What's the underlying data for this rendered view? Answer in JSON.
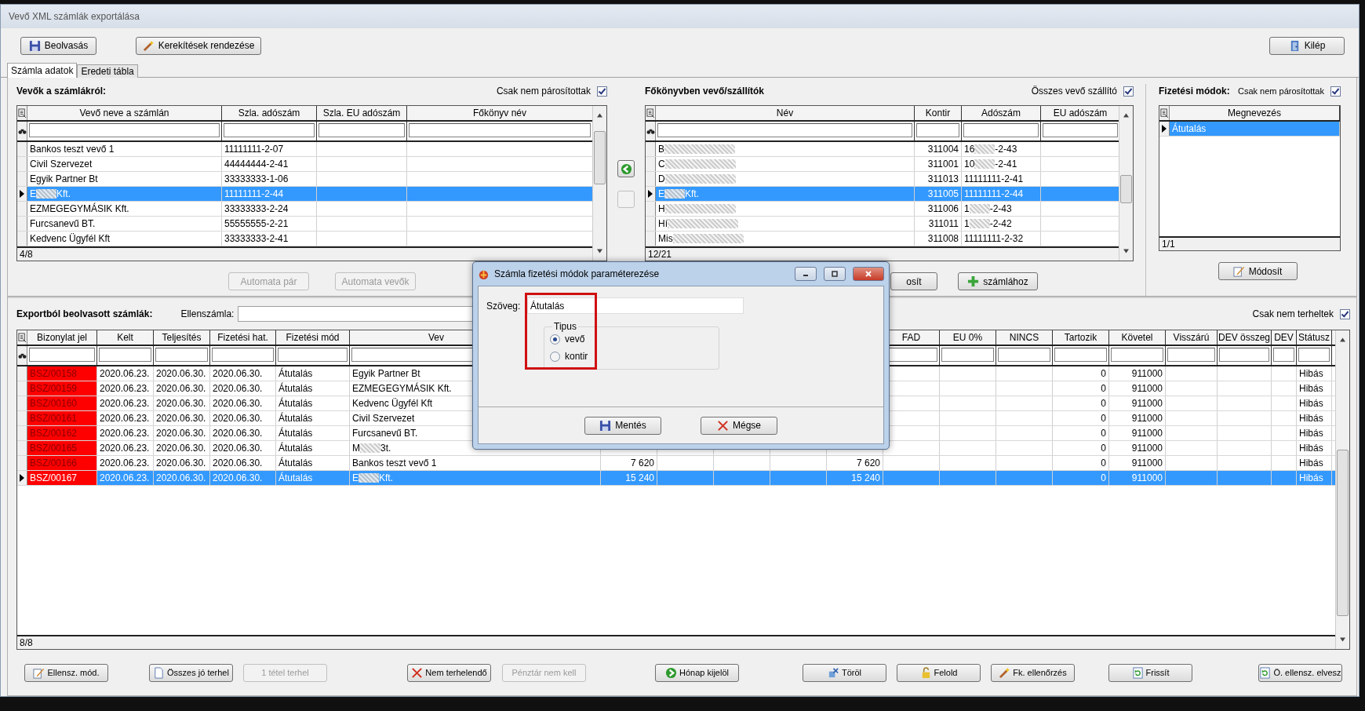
{
  "window": {
    "title": "Vevő XML számlák exportálása"
  },
  "toolbar": [
    {
      "label": "Beolvasás"
    },
    {
      "label": "Kerekítések rendezése"
    }
  ],
  "exit_button": {
    "label": "Kilép"
  },
  "tabs": [
    {
      "label": "Számla adatok",
      "selected": true
    },
    {
      "label": "Eredeti tábla",
      "selected": false
    }
  ],
  "customers": {
    "title": "Vevők a számlákról:",
    "filter": {
      "label": "Csak nem párosítottak",
      "checked": true
    },
    "columns": [
      "Vevő neve a számlán",
      "Szla. adószám",
      "Szla. EU adószám",
      "Főkönyv név"
    ],
    "rows": [
      {
        "name": "Bankos teszt vevő 1",
        "tax": "11111111-2-07",
        "selected": false
      },
      {
        "name": "Civil Szervezet",
        "tax": "44444444-2-41",
        "selected": false
      },
      {
        "name": "Egyik Partner Bt",
        "tax": "33333333-1-06",
        "selected": false
      },
      {
        "name": "E",
        "blurred": true,
        "name_tail": "Kft.",
        "tax": "11111111-2-44",
        "selected": true
      },
      {
        "name": "EZMEGEGYMÁSIK Kft.",
        "tax": "33333333-2-24",
        "selected": false
      },
      {
        "name": "Furcsanevű BT.",
        "tax": "55555555-2-21",
        "selected": false
      },
      {
        "name": "Kedvenc Ügyfél Kft",
        "tax": "33333333-2-41",
        "selected": false
      }
    ],
    "count": "4/8",
    "buttons": [
      {
        "label": "Automata pár",
        "disabled": true
      },
      {
        "label": "Automata vevők",
        "disabled": true
      }
    ]
  },
  "ledger": {
    "title": "Főkönyvben vevő/szállítók",
    "filter": {
      "label": "Összes vevő szállító",
      "checked": true
    },
    "columns": [
      "Név",
      "Kontir",
      "Adószám",
      "EU adószám"
    ],
    "rows": [
      {
        "name": "B",
        "blurred": true,
        "account": "311004",
        "tax": "16",
        "tax_blurred": true,
        "tax_tail": "-2-43",
        "selected": false
      },
      {
        "name": "C",
        "blurred": true,
        "account": "311001",
        "tax": "10",
        "tax_blurred": true,
        "tax_tail": "-2-41",
        "selected": false
      },
      {
        "name": "D",
        "blurred": true,
        "account": "311013",
        "tax": "11111111-2-41",
        "selected": false
      },
      {
        "name": "E",
        "blurred": true,
        "name_tail": "Kft.",
        "account": "311005",
        "tax": "11111111-2-44",
        "selected": true
      },
      {
        "name": "H",
        "blurred": true,
        "account": "311006",
        "tax": "1",
        "tax_blurred": true,
        "tax_tail": "-2-43",
        "selected": false
      },
      {
        "name": "Hí",
        "blurred": true,
        "account": "311011",
        "tax": "1",
        "tax_blurred": true,
        "tax_tail": "-2-42",
        "selected": false
      },
      {
        "name": "Mis",
        "blurred": true,
        "account": "311008",
        "tax": "11111111-2-32",
        "selected": false
      }
    ],
    "count": "12/21",
    "buttons": [
      {
        "label": "osít"
      },
      {
        "label": "számlához"
      }
    ]
  },
  "payment_methods": {
    "title": "Fizetési módok:",
    "filter": {
      "label": "Csak nem párosítottak",
      "checked": true
    },
    "columns": [
      "Megnevezés"
    ],
    "rows": [
      {
        "name": "Átutalás",
        "selected": true
      }
    ],
    "count": "1/1",
    "button": {
      "label": "Módosít"
    }
  },
  "invoices": {
    "title": "Exportból beolvasott számlák:",
    "counter_account": {
      "label": "Ellenszámla:"
    },
    "filter": {
      "label": "Csak nem terheltek",
      "checked": true
    },
    "columns": [
      "Bizonylat jel",
      "Kelt",
      "Teljesítés",
      "Fizetési hat.",
      "Fizetési mód",
      "Vev",
      "FAD",
      "EU 0%",
      "NINCS",
      "Tartozik",
      "Követel",
      "Visszárú",
      "DEV összeg",
      "DEV",
      "Státusz"
    ],
    "rows": [
      {
        "doc": "BSZ/00158",
        "flagged": true,
        "date": "2020.06.23.",
        "fulfilment": "2020.06.30.",
        "due": "2020.06.30.",
        "method": "Átutalás",
        "customer": "Egyik Partner Bt",
        "debit": "0",
        "credit": "911000",
        "status": "Hibás",
        "selected": false
      },
      {
        "doc": "BSZ/00159",
        "flagged": true,
        "date": "2020.06.23.",
        "fulfilment": "2020.06.30.",
        "due": "2020.06.30.",
        "method": "Átutalás",
        "customer": "EZMEGEGYMÁSIK Kft.",
        "debit": "0",
        "credit": "911000",
        "status": "Hibás",
        "selected": false
      },
      {
        "doc": "BSZ/00160",
        "flagged": true,
        "date": "2020.06.23.",
        "fulfilment": "2020.06.30.",
        "due": "2020.06.30.",
        "method": "Átutalás",
        "customer": "Kedvenc Ügyfél Kft",
        "debit": "0",
        "credit": "911000",
        "status": "Hibás",
        "selected": false
      },
      {
        "doc": "BSZ/00161",
        "flagged": true,
        "date": "2020.06.23.",
        "fulfilment": "2020.06.30.",
        "due": "2020.06.30.",
        "method": "Átutalás",
        "customer": "Civil Szervezet",
        "debit": "0",
        "credit": "911000",
        "status": "Hibás",
        "selected": false
      },
      {
        "doc": "BSZ/00162",
        "flagged": true,
        "date": "2020.06.23.",
        "fulfilment": "2020.06.30.",
        "due": "2020.06.30.",
        "method": "Átutalás",
        "customer": "Furcsanevű BT.",
        "debit": "0",
        "credit": "911000",
        "status": "Hibás",
        "selected": false
      },
      {
        "doc": "BSZ/00165",
        "flagged": true,
        "date": "2020.06.23.",
        "fulfilment": "2020.06.30.",
        "due": "2020.06.30.",
        "method": "Átutalás",
        "customer": "M",
        "customer_blurred": true,
        "customer_tail": "3t.",
        "debit": "0",
        "credit": "911000",
        "status": "Hibás",
        "selected": false
      },
      {
        "doc": "BSZ/00166",
        "flagged": true,
        "date": "2020.06.23.",
        "fulfilment": "2020.06.30.",
        "due": "2020.06.30.",
        "method": "Átutalás",
        "customer": "Bankos teszt vevő 1",
        "column_7": "7 620",
        "column_11": "7 620",
        "debit": "0",
        "credit": "911000",
        "status": "Hibás",
        "selected": false
      },
      {
        "doc": "BSZ/00167",
        "flagged": true,
        "date": "2020.06.23.",
        "fulfilment": "2020.06.30.",
        "due": "2020.06.30.",
        "method": "Átutalás",
        "customer": "E",
        "customer_blurred": true,
        "customer_tail": "Kft.",
        "column_7": "15 240",
        "column_11": "15 240",
        "debit": "0",
        "credit": "911000",
        "status": "Hibás",
        "selected": true
      }
    ],
    "count": "8/8"
  },
  "bottom_buttons": [
    {
      "label": "Ellensz. mód.",
      "disabled": false
    },
    {
      "label": "Összes jó terhel",
      "disabled": false
    },
    {
      "label": "1 tétel terhel",
      "disabled": true
    },
    {
      "label": "Nem terhelendő",
      "disabled": false
    },
    {
      "label": "Pénztár nem kell",
      "disabled": true
    },
    {
      "label": "Hónap kijelöl",
      "disabled": false
    },
    {
      "label": "Töröl",
      "disabled": false
    },
    {
      "label": "Felold",
      "disabled": false
    },
    {
      "label": "Fk. ellenőrzés",
      "disabled": false
    },
    {
      "label": "Frissít",
      "disabled": false
    },
    {
      "label": "Ö. ellensz. elvesz",
      "disabled": false
    }
  ],
  "dialog": {
    "title": "Számla fizetési módok paraméterezése",
    "text_field": {
      "label": "Szöveg:",
      "value": "Átutalás"
    },
    "type_group": {
      "label": "Tipus",
      "options": [
        {
          "label": "vevő",
          "selected": true
        },
        {
          "label": "kontir",
          "selected": false
        }
      ]
    },
    "buttons": [
      {
        "label": "Mentés"
      },
      {
        "label": "Mégse"
      }
    ]
  }
}
